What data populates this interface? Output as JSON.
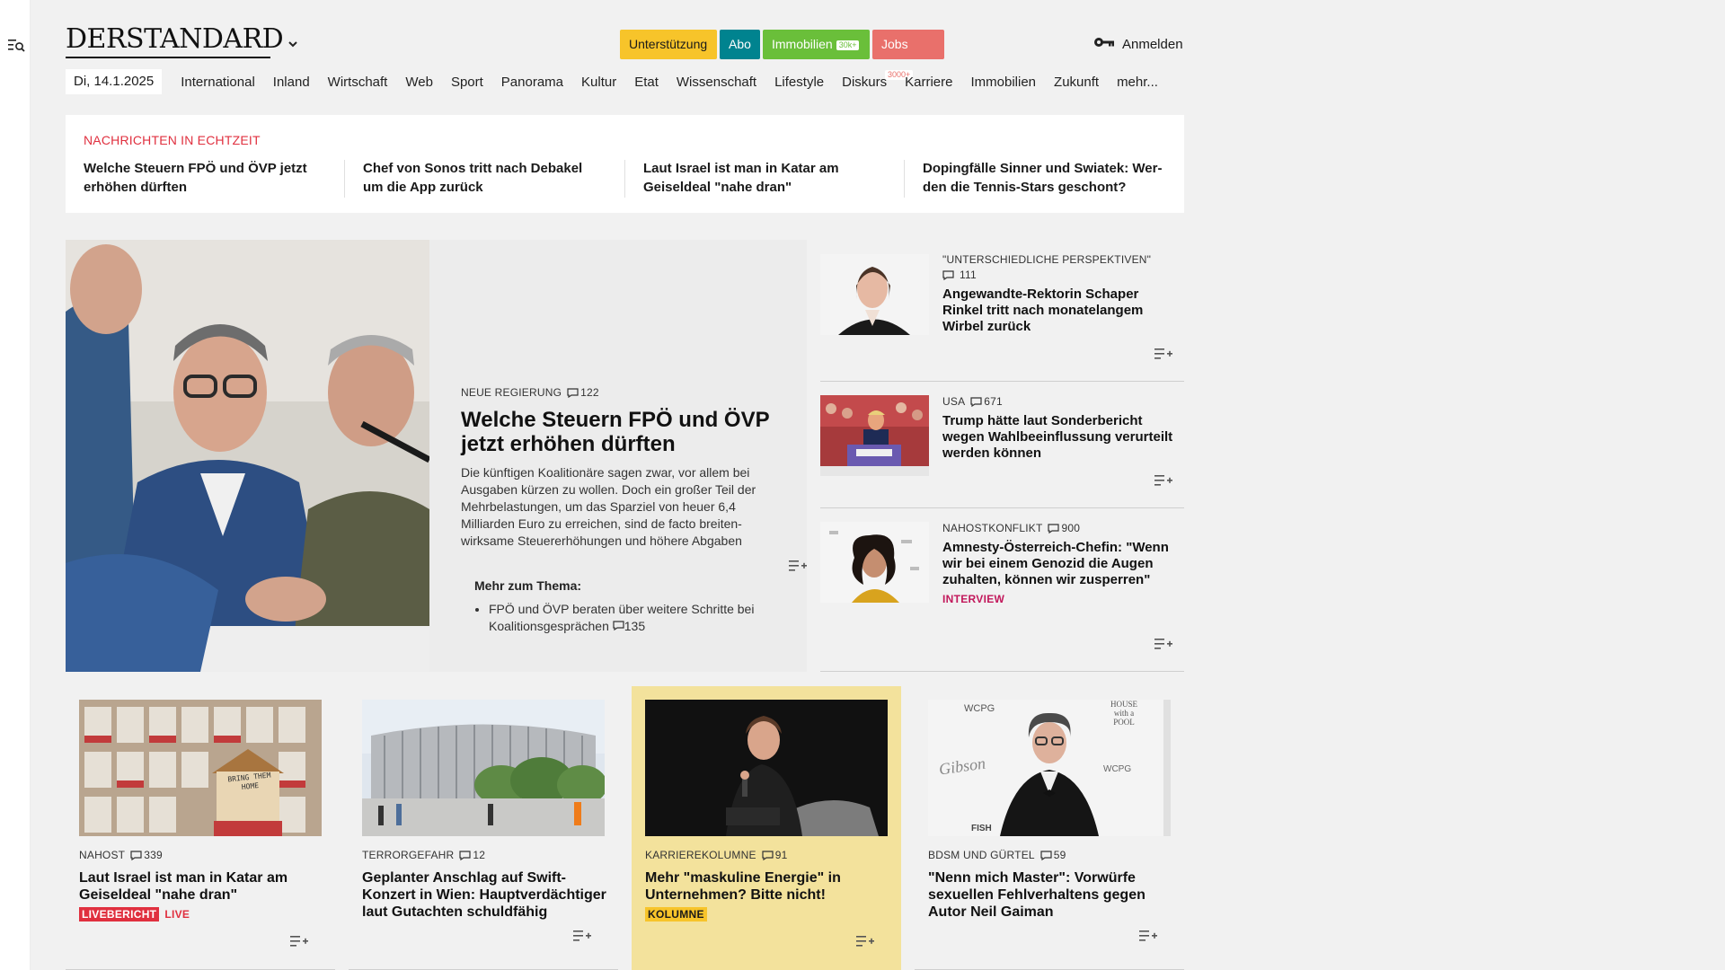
{
  "header": {
    "logo": "DERSTANDARD",
    "cta": {
      "support": "Unterstützung",
      "abo": "Abo",
      "immobilien": "Immobilien",
      "immobilien_badge": "30k+",
      "jobs": "Jobs",
      "jobs_badge": "3000+"
    },
    "login": "Anmelden"
  },
  "nav": {
    "date": "Di, 14.1.2025",
    "items": [
      "International",
      "Inland",
      "Wirtschaft",
      "Web",
      "Sport",
      "Panorama",
      "Kultur",
      "Etat",
      "Wissenschaft",
      "Lifestyle",
      "Diskurs",
      "Karriere",
      "Immobilien",
      "Zukunft",
      "mehr..."
    ]
  },
  "ticker": {
    "label": "NACHRICHTEN IN ECHTZEIT",
    "items": [
      "Welche Steuern FPÖ und ÖVP jetzt er­höhen dürften",
      "Chef von Sonos tritt nach Debakel um die App zurück",
      "Laut Israel ist man in Katar am Geisel­deal \"nahe dran\"",
      "Dopingfälle Sinner und Swiatek: Wer­den die Tennis-Stars geschont?"
    ]
  },
  "lead": {
    "kicker": "NEUE REGIERUNG",
    "comments": "122",
    "title": "Welche Steuern FPÖ und ÖVP jetzt erhöhen dürften",
    "body": "Die künftigen Koalitionäre sagen zwar, vor allem bei Ausgaben kürzen zu wollen. Doch ein großer Teil der Mehrbelastungen, um das Sparziel von heuer 6,4 Milliarden Euro zu erreichen, sind de facto breiten­wirksame Steuererhöhungen und höhere Abgaben",
    "more_label": "Mehr zum Thema:",
    "more_items": [
      {
        "text": "FPÖ und ÖVP beraten über weitere Schritte bei Koalitionsgesprächen",
        "comments": "135"
      }
    ]
  },
  "side": [
    {
      "kicker": "\"UNTERSCHIEDLICHE PERSPEKTIVEN\"",
      "comments": "111",
      "title": "Angewandte-Rektorin Schaper Rinkel tritt nach monatelangem Wirbel zurück",
      "tag": ""
    },
    {
      "kicker": "USA",
      "comments": "671",
      "title": "Trump hätte laut Sonderbericht wegen Wahlbeeinflussung verurteilt werden können",
      "tag": ""
    },
    {
      "kicker": "NAHOSTKONFLIKT",
      "comments": "900",
      "title": "Amnesty-Österreich-Chefin: \"Wenn wir bei einem Genozid die Augen zuhalten, können wir zusperren\"",
      "tag": "INTERVIEW"
    }
  ],
  "cards": [
    {
      "kicker": "NAHOST",
      "comments": "339",
      "title": "Laut Israel ist man in Katar am Geiseldeal \"nahe dran\"",
      "tag1": "LIVEBERICHT",
      "tag2": "LIVE",
      "image_text": "BRING THEM HOME"
    },
    {
      "kicker": "TERRORGEFAHR",
      "comments": "12",
      "title": "Geplanter Anschlag auf Swift-Konzert in Wien: Hauptverdächti­ger laut Gutachten schuldfähig"
    },
    {
      "kicker": "KARRIEREKOLUMNE",
      "comments": "91",
      "title": "Mehr \"maskuline Energie\" in Unternehmen? Bitte nicht!",
      "tag": "KOLUMNE"
    },
    {
      "kicker": "BDSM UND GÜRTEL",
      "comments": "59",
      "title": "\"Nenn mich Master\": Vorwürfe sexuellen Fehlverhaltens gegen Autor Neil Gaiman",
      "image_texts": [
        "WCPG",
        "HOUSE with a POOL",
        "Gibson",
        "WCPG",
        "FISH"
      ]
    }
  ],
  "colors": {
    "accent_red": "#e0303f",
    "support_yellow": "#f7c42a",
    "abo_teal": "#00838f",
    "immobilien_green": "#6abf3a",
    "jobs_salmon": "#e9706b",
    "interview_magenta": "#c2185b",
    "kolumne_bg": "#f3e29c"
  },
  "icons": {
    "menu": "menu-search-icon",
    "chevron": "chevron-down-icon",
    "login": "key-icon",
    "comment": "comment-icon",
    "add_to_list": "add-to-list-icon"
  }
}
